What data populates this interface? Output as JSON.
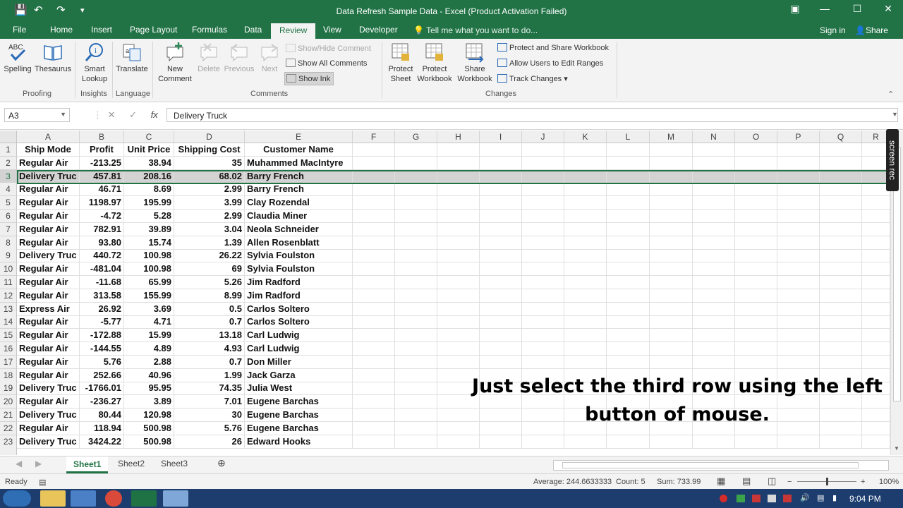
{
  "window": {
    "title": "Data Refresh Sample Data - Excel (Product Activation Failed)",
    "minimize": "—",
    "maximize": "☐",
    "close": "✕"
  },
  "tabs": [
    "File",
    "Home",
    "Insert",
    "Page Layout",
    "Formulas",
    "Data",
    "Review",
    "View",
    "Developer"
  ],
  "tell_me": "Tell me what you want to do...",
  "sign_in": "Sign in",
  "share": "Share",
  "ribbon": {
    "spelling": "Spelling",
    "spelling_abc": "ABC",
    "thesaurus": "Thesaurus",
    "smart_lookup_1": "Smart",
    "smart_lookup_2": "Lookup",
    "translate": "Translate",
    "new_comment_1": "New",
    "new_comment_2": "Comment",
    "delete": "Delete",
    "previous": "Previous",
    "next": "Next",
    "show_hide_comment": "Show/Hide Comment",
    "show_all_comments": "Show All Comments",
    "show_ink": "Show Ink",
    "protect_sheet_1": "Protect",
    "protect_sheet_2": "Sheet",
    "protect_workbook_1": "Protect",
    "protect_workbook_2": "Workbook",
    "share_workbook_1": "Share",
    "share_workbook_2": "Workbook",
    "protect_share_workbook": "Protect and Share Workbook",
    "allow_users": "Allow Users to Edit Ranges",
    "track_changes": "Track Changes",
    "groups": {
      "proofing": "Proofing",
      "insights": "Insights",
      "language": "Language",
      "comments": "Comments",
      "changes": "Changes"
    }
  },
  "formula_bar": {
    "name_box": "A3",
    "fx": "fx",
    "cancel": "✕",
    "enter": "✓",
    "value": "Delivery Truck"
  },
  "columns": [
    "A",
    "B",
    "C",
    "D",
    "E",
    "F",
    "G",
    "H",
    "I",
    "J",
    "K",
    "L",
    "M",
    "N",
    "O",
    "P",
    "Q",
    "R"
  ],
  "rows": [
    {
      "num": "1",
      "cells": [
        "Ship Mode",
        "Profit",
        "Unit Price",
        "Shipping Cost",
        "Customer Name"
      ]
    },
    {
      "num": "2",
      "cells": [
        "Regular Air",
        "-213.25",
        "38.94",
        "35",
        "Muhammed MacIntyre"
      ]
    },
    {
      "num": "3",
      "cells": [
        "Delivery Truc",
        "457.81",
        "208.16",
        "68.02",
        "Barry French"
      ]
    },
    {
      "num": "4",
      "cells": [
        "Regular Air",
        "46.71",
        "8.69",
        "2.99",
        "Barry French"
      ]
    },
    {
      "num": "5",
      "cells": [
        "Regular Air",
        "1198.97",
        "195.99",
        "3.99",
        "Clay Rozendal"
      ]
    },
    {
      "num": "6",
      "cells": [
        "Regular Air",
        "-4.72",
        "5.28",
        "2.99",
        "Claudia Miner"
      ]
    },
    {
      "num": "7",
      "cells": [
        "Regular Air",
        "782.91",
        "39.89",
        "3.04",
        "Neola Schneider"
      ]
    },
    {
      "num": "8",
      "cells": [
        "Regular Air",
        "93.80",
        "15.74",
        "1.39",
        "Allen Rosenblatt"
      ]
    },
    {
      "num": "9",
      "cells": [
        "Delivery Truc",
        "440.72",
        "100.98",
        "26.22",
        "Sylvia Foulston"
      ]
    },
    {
      "num": "10",
      "cells": [
        "Regular Air",
        "-481.04",
        "100.98",
        "69",
        "Sylvia Foulston"
      ]
    },
    {
      "num": "11",
      "cells": [
        "Regular Air",
        "-11.68",
        "65.99",
        "5.26",
        "Jim Radford"
      ]
    },
    {
      "num": "12",
      "cells": [
        "Regular Air",
        "313.58",
        "155.99",
        "8.99",
        "Jim Radford"
      ]
    },
    {
      "num": "13",
      "cells": [
        "Express Air",
        "26.92",
        "3.69",
        "0.5",
        "Carlos Soltero"
      ]
    },
    {
      "num": "14",
      "cells": [
        "Regular Air",
        "-5.77",
        "4.71",
        "0.7",
        "Carlos Soltero"
      ]
    },
    {
      "num": "15",
      "cells": [
        "Regular Air",
        "-172.88",
        "15.99",
        "13.18",
        "Carl Ludwig"
      ]
    },
    {
      "num": "16",
      "cells": [
        "Regular Air",
        "-144.55",
        "4.89",
        "4.93",
        "Carl Ludwig"
      ]
    },
    {
      "num": "17",
      "cells": [
        "Regular Air",
        "5.76",
        "2.88",
        "0.7",
        "Don Miller"
      ]
    },
    {
      "num": "18",
      "cells": [
        "Regular Air",
        "252.66",
        "40.96",
        "1.99",
        "Jack Garza"
      ]
    },
    {
      "num": "19",
      "cells": [
        "Delivery Truc",
        "-1766.01",
        "95.95",
        "74.35",
        "Julia West"
      ]
    },
    {
      "num": "20",
      "cells": [
        "Regular Air",
        "-236.27",
        "3.89",
        "7.01",
        "Eugene Barchas"
      ]
    },
    {
      "num": "21",
      "cells": [
        "Delivery Truc",
        "80.44",
        "120.98",
        "30",
        "Eugene Barchas"
      ]
    },
    {
      "num": "22",
      "cells": [
        "Regular Air",
        "118.94",
        "500.98",
        "5.76",
        "Eugene Barchas"
      ]
    },
    {
      "num": "23",
      "cells": [
        "Delivery Truc",
        "3424.22",
        "500.98",
        "26",
        "Edward Hooks"
      ]
    }
  ],
  "selected_row": "3",
  "sheets": [
    "Sheet1",
    "Sheet2",
    "Sheet3"
  ],
  "status": {
    "ready": "Ready",
    "average": "Average: 244.6633333",
    "count": "Count: 5",
    "sum": "Sum: 733.99",
    "zoom": "100%"
  },
  "screen_rec": "screen rec",
  "caption": "Just select the third row using the left button of mouse.",
  "clock": "9:04 PM",
  "colors": {
    "excel_green": "#217346",
    "selection_gray": "#d3d3d3",
    "taskbar": "#1c3d6e"
  }
}
